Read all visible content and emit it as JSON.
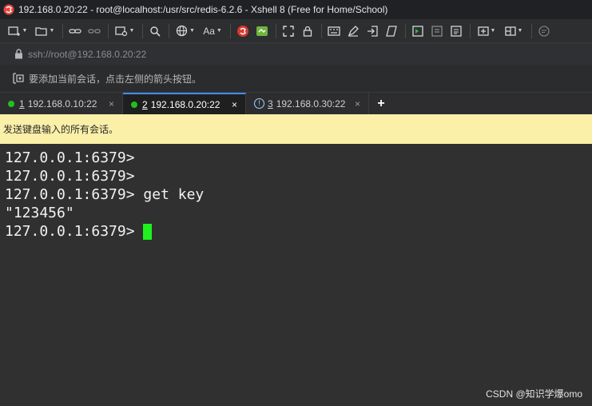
{
  "window": {
    "title": "192.168.0.20:22 - root@localhost:/usr/src/redis-6.2.6 - Xshell 8 (Free for Home/School)"
  },
  "toolbar": {
    "font_button_label": "Aa"
  },
  "address": {
    "url": "ssh://root@192.168.0.20:22"
  },
  "hint": {
    "text": "要添加当前会话，点击左侧的箭头按钮。"
  },
  "tabs": [
    {
      "num": "1",
      "label": "192.168.0.10:22",
      "status": "connected",
      "close": "×"
    },
    {
      "num": "2",
      "label": "192.168.0.20:22",
      "status": "connected",
      "close": "×",
      "active": true
    },
    {
      "num": "3",
      "label": "192.168.0.30:22",
      "status": "warning",
      "close": "×"
    }
  ],
  "tab_add": "+",
  "send_bar": {
    "text": "发送键盘输入的所有会话。"
  },
  "terminal": {
    "lines": [
      "127.0.0.1:6379>",
      "127.0.0.1:6379>",
      "127.0.0.1:6379> get key",
      "\"123456\"",
      "127.0.0.1:6379> "
    ]
  },
  "watermark": "CSDN @知识学爆omo",
  "colors": {
    "accent": "#3d8eff",
    "status_connected": "#1fc01f",
    "send_bar_bg": "#fbf0a8",
    "cursor": "#1ef11e"
  }
}
